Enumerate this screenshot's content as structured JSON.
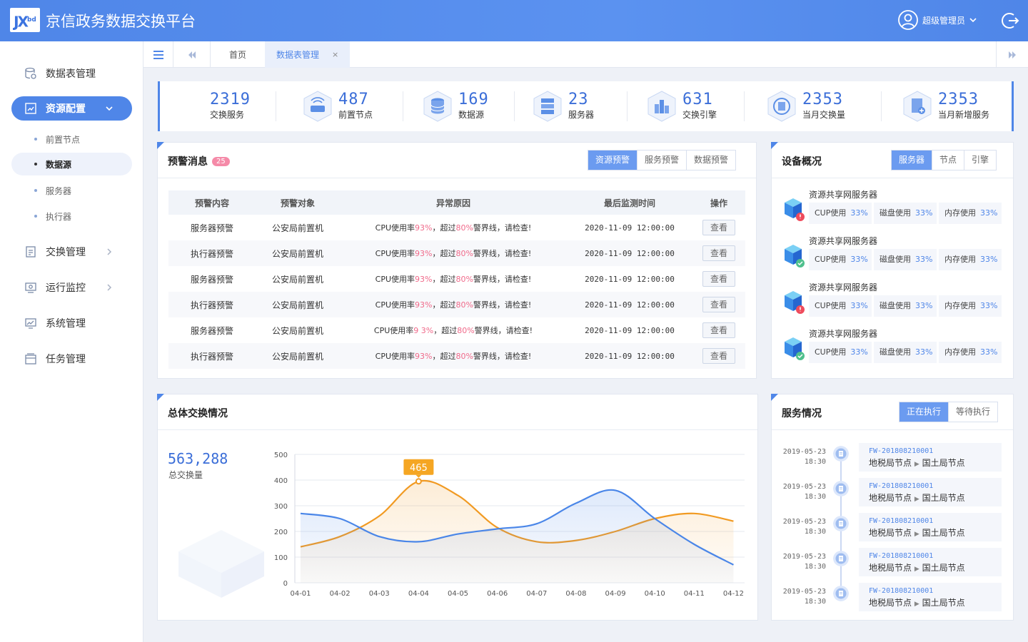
{
  "header": {
    "logo": "JX",
    "logo_sup": "bd",
    "title": "京信政务数据交换平台",
    "user": "超级管理员"
  },
  "sidebar": {
    "items": [
      {
        "label": "数据表管理"
      },
      {
        "label": "资源配置"
      },
      {
        "label": "交换管理"
      },
      {
        "label": "运行监控"
      },
      {
        "label": "系统管理"
      },
      {
        "label": "任务管理"
      }
    ],
    "subitems": [
      {
        "label": "前置节点"
      },
      {
        "label": "数据源"
      },
      {
        "label": "服务器"
      },
      {
        "label": "执行器"
      }
    ]
  },
  "tabs": [
    {
      "label": "首页"
    },
    {
      "label": "数据表管理"
    }
  ],
  "stats": [
    {
      "value": "2319",
      "label": "交换服务"
    },
    {
      "value": "487",
      "label": "前置节点"
    },
    {
      "value": "169",
      "label": "数据源"
    },
    {
      "value": "23",
      "label": "服务器"
    },
    {
      "value": "631",
      "label": "交换引擎"
    },
    {
      "value": "2353",
      "label": "当月交换量"
    },
    {
      "value": "2353",
      "label": "当月新增服务"
    }
  ],
  "warnings": {
    "title": "预警消息",
    "count": "25",
    "buttons": [
      "资源预警",
      "服务预警",
      "数据预警"
    ],
    "columns": [
      "预警内容",
      "预警对象",
      "异常原因",
      "最后监测时间",
      "操作"
    ],
    "reason_parts": {
      "a": "CPU使用率",
      "pct1": "93%",
      "b": "，超过",
      "pct2": "80%",
      "c": "警界线，请检查!"
    },
    "reason_pct1_alt": "9 3%",
    "rows": [
      {
        "content": "服务器预警",
        "target": "公安局前置机",
        "time": "2020-11-09 12:00:00",
        "action": "查看"
      },
      {
        "content": "执行器预警",
        "target": "公安局前置机",
        "time": "2020-11-09 12:00:00",
        "action": "查看"
      },
      {
        "content": "服务器预警",
        "target": "公安局前置机",
        "time": "2020-11-09 12:00:00",
        "action": "查看"
      },
      {
        "content": "执行器预警",
        "target": "公安局前置机",
        "time": "2020-11-09 12:00:00",
        "action": "查看"
      },
      {
        "content": "服务器预警",
        "target": "公安局前置机",
        "time": "2020-11-09 12:00:00",
        "action": "查看"
      },
      {
        "content": "执行器预警",
        "target": "公安局前置机",
        "time": "2020-11-09 12:00:00",
        "action": "查看"
      }
    ]
  },
  "devices": {
    "title": "设备概况",
    "buttons": [
      "服务器",
      "节点",
      "引擎"
    ],
    "items": [
      {
        "name": "资源共享网服务器",
        "status": "warning",
        "cpu_label": "CUP使用",
        "cpu": "33%",
        "disk_label": "磁盘使用",
        "disk": "33%",
        "mem_label": "内存使用",
        "mem": "33%"
      },
      {
        "name": "资源共享网服务器",
        "status": "ok",
        "cpu_label": "CUP使用",
        "cpu": "33%",
        "disk_label": "磁盘使用",
        "disk": "33%",
        "mem_label": "内存使用",
        "mem": "33%"
      },
      {
        "name": "资源共享网服务器",
        "status": "warning",
        "cpu_label": "CUP使用",
        "cpu": "33%",
        "disk_label": "磁盘使用",
        "disk": "33%",
        "mem_label": "内存使用",
        "mem": "33%"
      },
      {
        "name": "资源共享网服务器",
        "status": "ok",
        "cpu_label": "CUP使用",
        "cpu": "33%",
        "disk_label": "磁盘使用",
        "disk": "33%",
        "mem_label": "内存使用",
        "mem": "33%"
      }
    ]
  },
  "exchange": {
    "title": "总体交换情况",
    "total": "563,288",
    "total_label": "总交换量"
  },
  "services": {
    "title": "服务情况",
    "buttons": [
      "正在执行",
      "等待执行"
    ],
    "items": [
      {
        "date": "2019-05-23",
        "time": "18:30",
        "id": "FW-201808210001",
        "from": "地税局节点",
        "to": "国土局节点"
      },
      {
        "date": "2019-05-23",
        "time": "18:30",
        "id": "FW-201808210001",
        "from": "地税局节点",
        "to": "国土局节点"
      },
      {
        "date": "2019-05-23",
        "time": "18:30",
        "id": "FW-201808210001",
        "from": "地税局节点",
        "to": "国土局节点"
      },
      {
        "date": "2019-05-23",
        "time": "18:30",
        "id": "FW-201808210001",
        "from": "地税局节点",
        "to": "国土局节点"
      },
      {
        "date": "2019-05-23",
        "time": "18:30",
        "id": "FW-201808210001",
        "from": "地税局节点",
        "to": "国土局节点"
      }
    ]
  },
  "chart_data": {
    "type": "line",
    "categories": [
      "04-01",
      "04-02",
      "04-03",
      "04-04",
      "04-05",
      "04-06",
      "04-07",
      "04-08",
      "04-09",
      "04-10",
      "04-11",
      "04-12"
    ],
    "series": [
      {
        "color": "#f19a22",
        "values": [
          140,
          180,
          260,
          395,
          340,
          215,
          160,
          165,
          200,
          250,
          270,
          240
        ]
      },
      {
        "color": "#4a86e8",
        "values": [
          270,
          250,
          180,
          160,
          190,
          210,
          230,
          310,
          360,
          250,
          150,
          70
        ]
      }
    ],
    "ylim": [
      0,
      500
    ],
    "yticks": [
      0,
      100,
      200,
      300,
      400,
      500
    ],
    "annotation": {
      "label": "465",
      "category": "04-04",
      "value": 395
    },
    "grid": true
  }
}
